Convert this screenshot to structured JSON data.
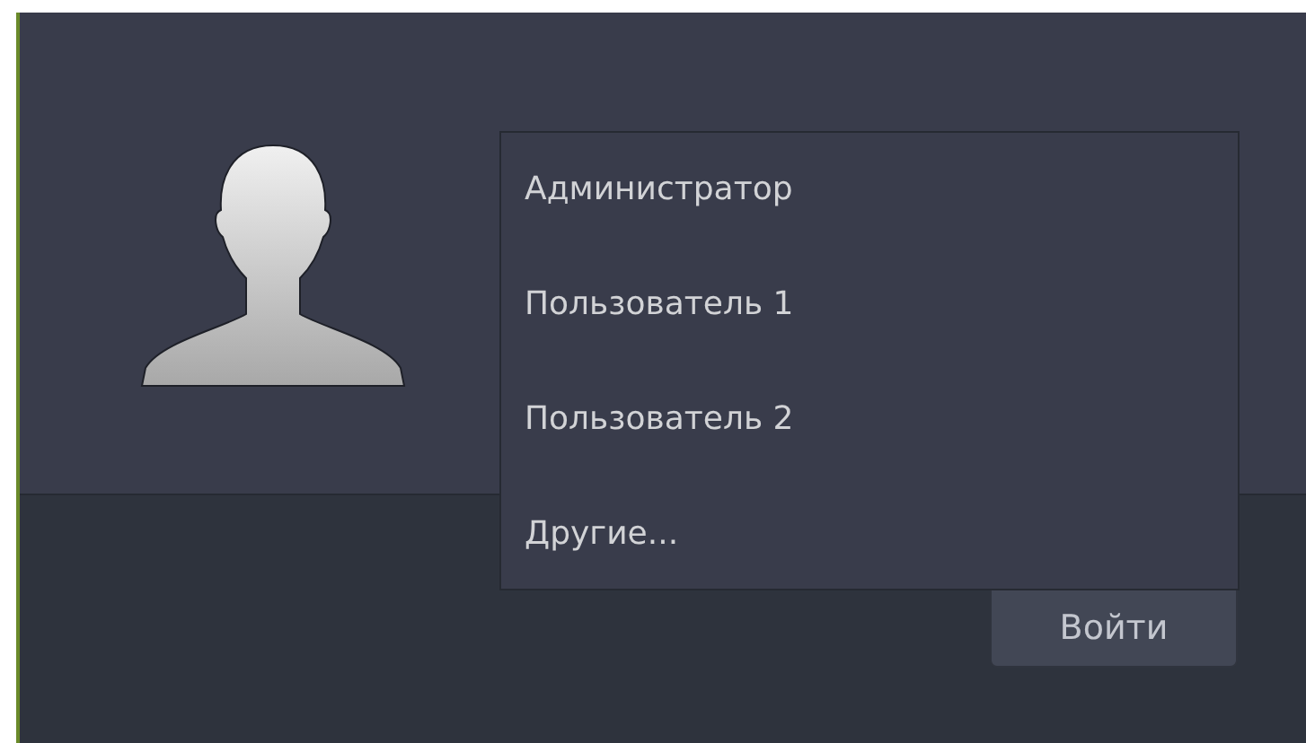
{
  "user_menu": {
    "items": [
      {
        "label": "Администратор"
      },
      {
        "label": "Пользователь 1"
      },
      {
        "label": "Пользователь 2"
      },
      {
        "label": "Другие..."
      }
    ]
  },
  "login_button": {
    "label": "Войти"
  }
}
